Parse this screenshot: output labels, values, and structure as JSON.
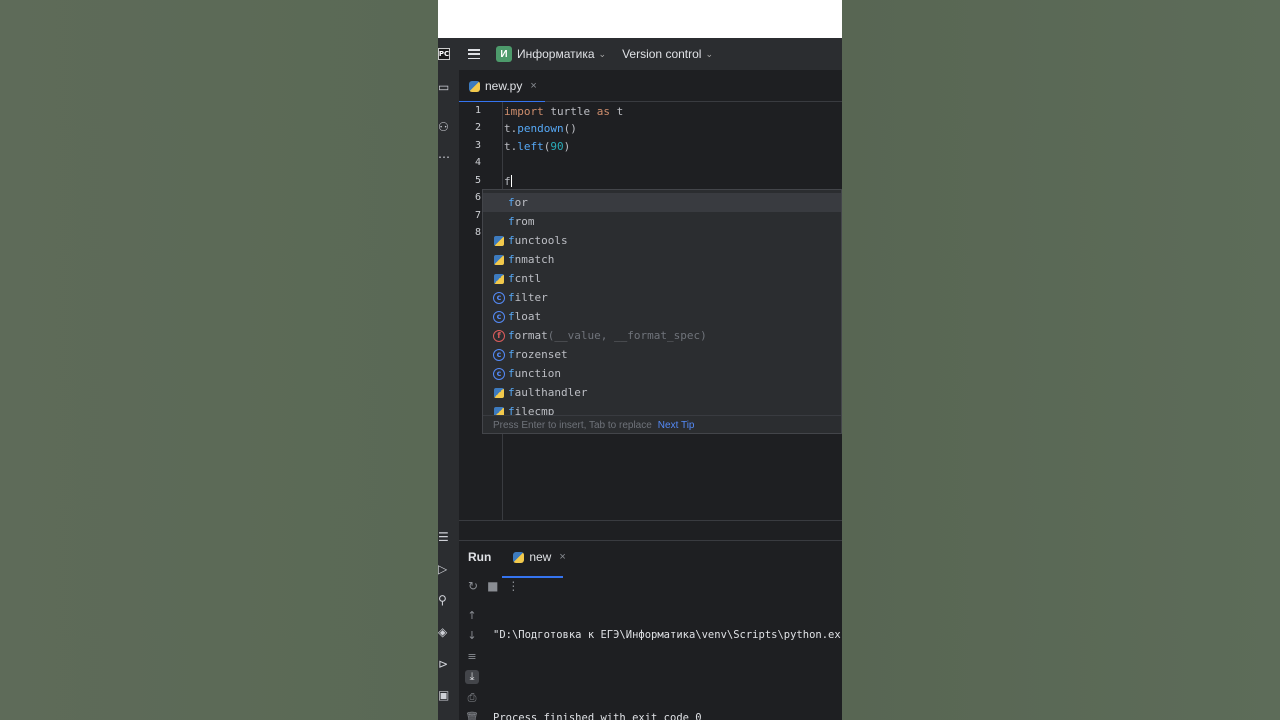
{
  "titlebar": {
    "ide_logo": "PC",
    "project_initial": "И",
    "project_name": "Информатика",
    "vcs_label": "Version control"
  },
  "tab": {
    "filename": "new.py",
    "close": "×"
  },
  "editor": {
    "line_numbers": [
      "1",
      "2",
      "3",
      "4",
      "5",
      "6",
      "7",
      "8"
    ],
    "lines": {
      "l1_kw1": "import",
      "l1_mid": " turtle ",
      "l1_kw2": "as",
      "l1_end": " t",
      "l2_obj": "t.",
      "l2_fn": "pendown",
      "l2_end": "()",
      "l3_obj": "t.",
      "l3_fn": "left",
      "l3_open": "(",
      "l3_num": "90",
      "l3_close": ")",
      "l5_typed": "f"
    }
  },
  "completion": {
    "items": [
      {
        "first": "f",
        "rest": "or",
        "hint": ""
      },
      {
        "first": "f",
        "rest": "rom",
        "hint": ""
      },
      {
        "first": "f",
        "rest": "unctools",
        "hint": ""
      },
      {
        "first": "f",
        "rest": "nmatch",
        "hint": ""
      },
      {
        "first": "f",
        "rest": "cntl",
        "hint": ""
      },
      {
        "first": "f",
        "rest": "ilter",
        "hint": ""
      },
      {
        "first": "f",
        "rest": "loat",
        "hint": ""
      },
      {
        "first": "f",
        "rest": "ormat",
        "hint": "(__value, __format_spec)"
      },
      {
        "first": "f",
        "rest": "rozenset",
        "hint": ""
      },
      {
        "first": "f",
        "rest": "unction",
        "hint": ""
      },
      {
        "first": "f",
        "rest": "aulthandler",
        "hint": ""
      },
      {
        "first": "f",
        "rest": "ilecmp",
        "hint": ""
      }
    ],
    "footer_text": "Press Enter to insert, Tab to replace",
    "footer_link": "Next Tip"
  },
  "run": {
    "label": "Run",
    "tab_name": "new",
    "tab_close": "×",
    "console_line1": "\"D:\\Подготовка к ЕГЭ\\Информатика\\venv\\Scripts\\python.ex",
    "console_line2": "",
    "console_line3": "Process finished with exit code 0"
  }
}
